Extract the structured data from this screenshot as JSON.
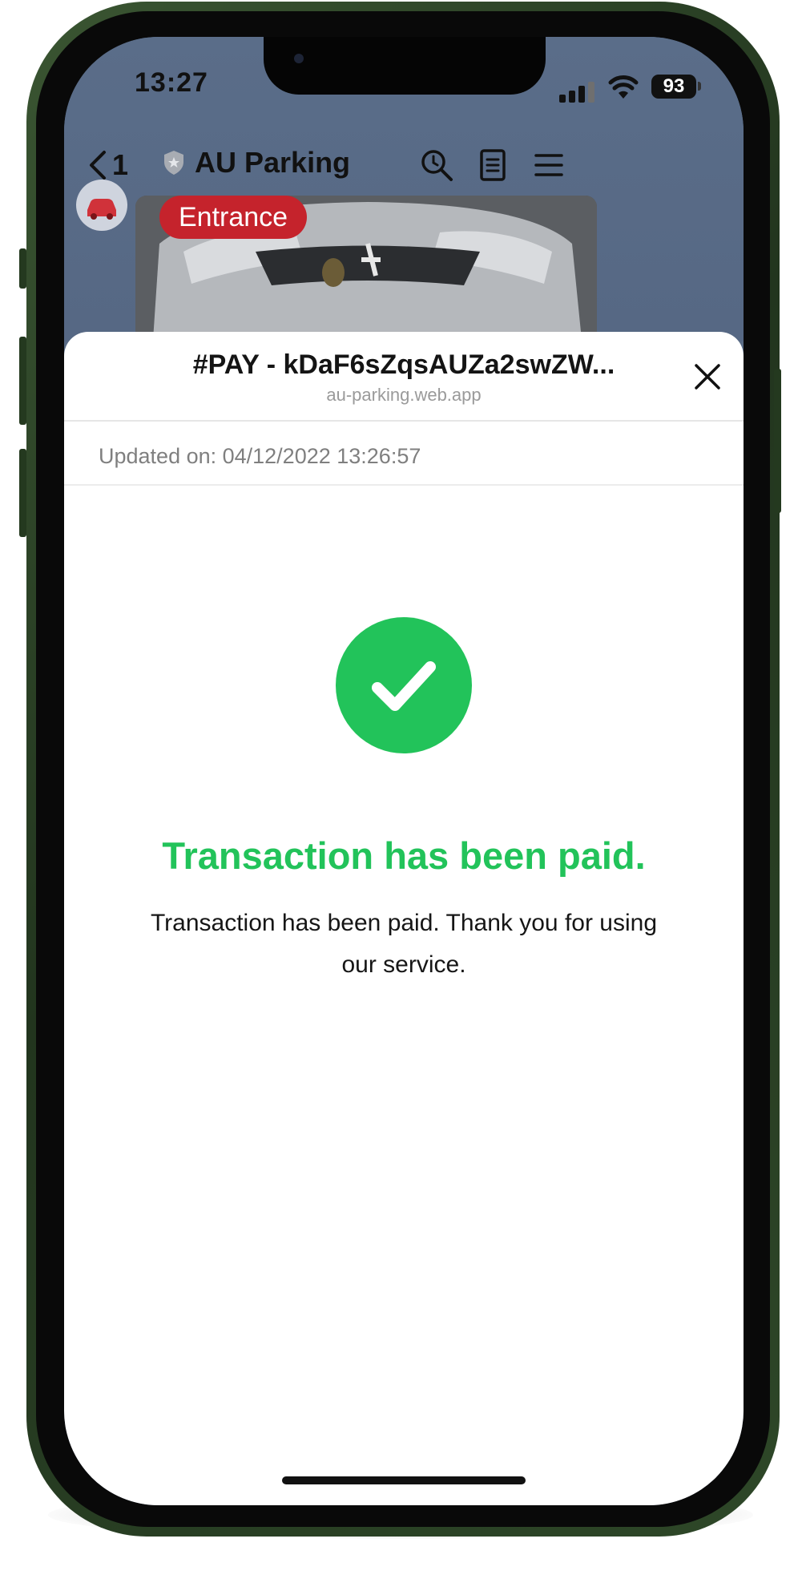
{
  "status_bar": {
    "time": "13:27",
    "battery": "93"
  },
  "chat_nav": {
    "back_count": "1",
    "title": "AU Parking"
  },
  "chat_message": {
    "badge": "Entrance"
  },
  "sheet": {
    "title": "#PAY - kDaF6sZqsAUZa2swZW...",
    "url": "au-parking.web.app",
    "updated": "Updated on: 04/12/2022 13:26:57"
  },
  "result": {
    "status": "paid",
    "title": "Transaction has been paid.",
    "message": "Transaction has been paid. Thank you for using our service."
  },
  "colors": {
    "success": "#22c35a",
    "badge": "#c5232c",
    "chat_header": "#5a6c86",
    "frame": "#2e4728"
  }
}
